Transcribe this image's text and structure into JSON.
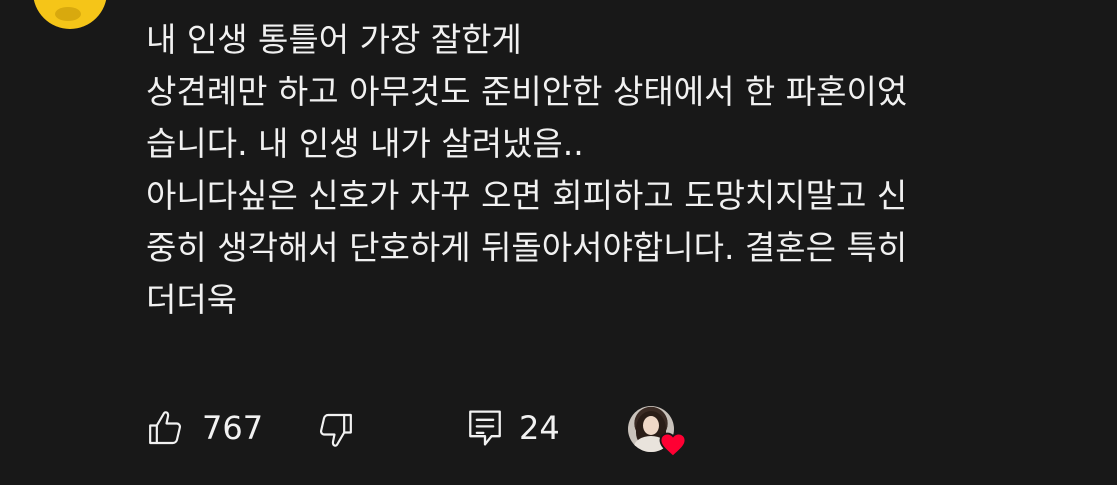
{
  "comment": {
    "lines": [
      "내 인생 통틀어 가장 잘한게",
      "상견례만 하고 아무것도 준비안한 상태에서 한 파혼이었",
      "습니다. 내 인생 내가 살려냈음..",
      "아니다싶은 신호가 자꾸 오면 회피하고 도망치지말고 신",
      "중히 생각해서 단호하게 뒤돌아서야합니다. 결혼은 특히",
      "더더욱"
    ]
  },
  "actions": {
    "like_count": "767",
    "reply_count": "24",
    "icons": {
      "like": "thumbs-up-icon",
      "dislike": "thumbs-down-icon",
      "reply": "comment-icon",
      "creator_heart": "heart-icon"
    }
  },
  "colors": {
    "background": "#181818",
    "text": "#f1f1f1",
    "heart": "#ff0033",
    "avatar_yellow": "#f5c518"
  }
}
